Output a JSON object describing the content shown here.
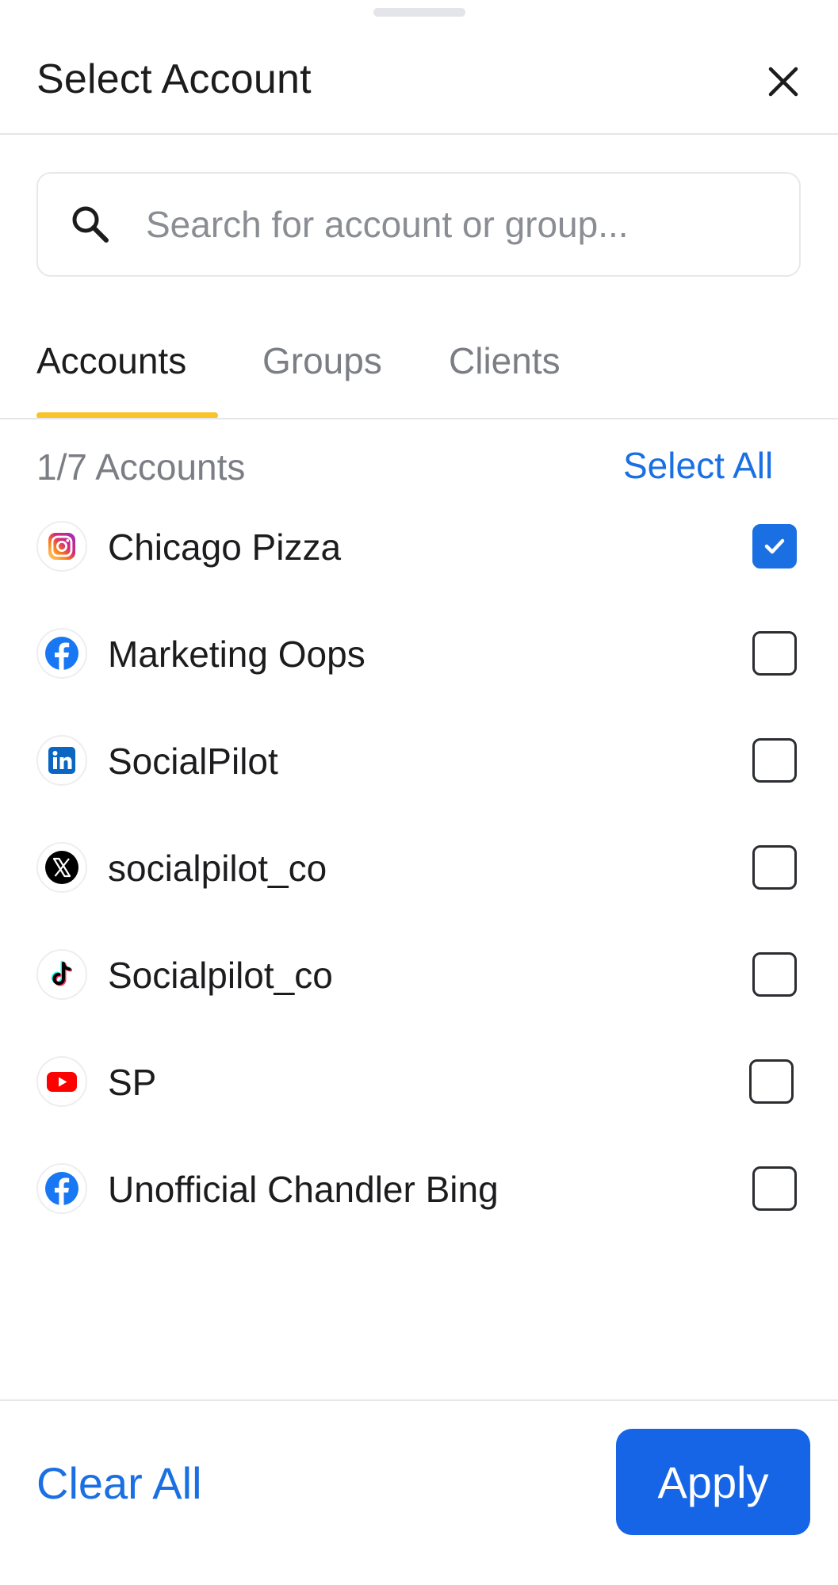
{
  "header": {
    "title": "Select Account"
  },
  "search": {
    "placeholder": "Search for account or group..."
  },
  "tabs": [
    {
      "label": "Accounts",
      "active": true
    },
    {
      "label": "Groups",
      "active": false
    },
    {
      "label": "Clients",
      "active": false
    }
  ],
  "list": {
    "count_label": "1/7 Accounts",
    "select_all_label": "Select All",
    "accounts": [
      {
        "name": "Chicago Pizza",
        "network": "instagram-icon",
        "checked": true
      },
      {
        "name": "Marketing Oops",
        "network": "facebook-icon",
        "checked": false
      },
      {
        "name": "SocialPilot",
        "network": "linkedin-icon",
        "checked": false
      },
      {
        "name": "socialpilot_co",
        "network": "x-icon",
        "checked": false
      },
      {
        "name": "Socialpilot_co",
        "network": "tiktok-icon",
        "checked": false
      },
      {
        "name": "SP",
        "network": "youtube-icon",
        "checked": false
      },
      {
        "name": "Unofficial Chandler Bing",
        "network": "facebook-icon",
        "checked": false
      }
    ]
  },
  "footer": {
    "clear_all_label": "Clear All",
    "apply_label": "Apply"
  },
  "colors": {
    "accent": "#1a6fe3",
    "apply_button": "#1565e6",
    "tab_indicator": "#f8c42a"
  }
}
